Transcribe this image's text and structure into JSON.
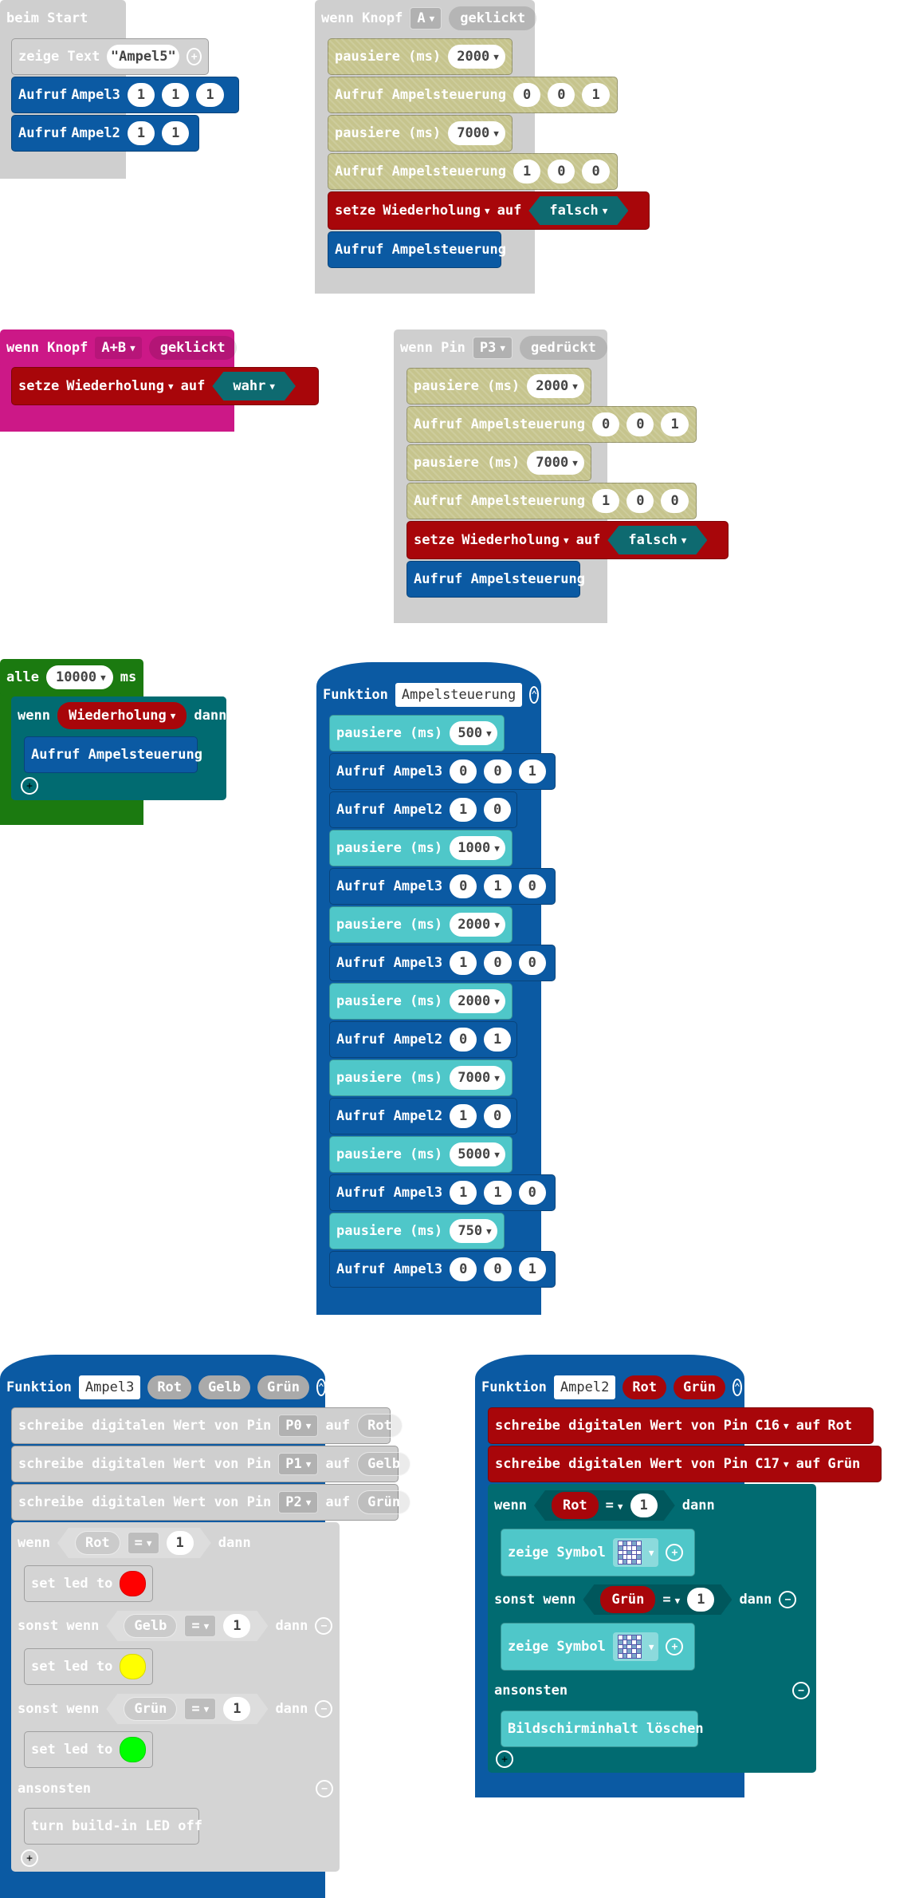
{
  "start": {
    "hat": "beim Start",
    "show_text": "zeige Text",
    "text_value": "\"Ampel5\"",
    "call": "Aufruf",
    "ampel3": "Ampel3",
    "ampel3_args": [
      "1",
      "1",
      "1"
    ],
    "ampel2": "Ampel2",
    "ampel2_args": [
      "1",
      "1"
    ]
  },
  "button_a": {
    "when": "wenn Knopf",
    "button": "A",
    "event": "geklickt",
    "steps": [
      {
        "label": "pausiere (ms)",
        "value": "2000"
      },
      {
        "label": "Aufruf Ampelsteuerung",
        "args": [
          "0",
          "0",
          "1"
        ]
      },
      {
        "label": "pausiere (ms)",
        "value": "7000"
      },
      {
        "label": "Aufruf Ampelsteuerung",
        "args": [
          "1",
          "0",
          "0"
        ]
      }
    ],
    "set": "setze",
    "var": "Wiederholung",
    "to": "auf",
    "value": "falsch",
    "call": "Aufruf Ampelsteuerung"
  },
  "button_ab": {
    "when": "wenn Knopf",
    "button": "A+B",
    "event": "geklickt",
    "set": "setze",
    "var": "Wiederholung",
    "to": "auf",
    "value": "wahr"
  },
  "pin_p3": {
    "when": "wenn Pin",
    "pin": "P3",
    "event": "gedrückt",
    "steps": [
      {
        "label": "pausiere (ms)",
        "value": "2000"
      },
      {
        "label": "Aufruf Ampelsteuerung",
        "args": [
          "0",
          "0",
          "1"
        ]
      },
      {
        "label": "pausiere (ms)",
        "value": "7000"
      },
      {
        "label": "Aufruf Ampelsteuerung",
        "args": [
          "1",
          "0",
          "0"
        ]
      }
    ],
    "set": "setze",
    "var": "Wiederholung",
    "to": "auf",
    "value": "falsch",
    "call": "Aufruf Ampelsteuerung"
  },
  "every": {
    "every": "alle",
    "interval": "10000",
    "unit": "ms",
    "if": "wenn",
    "var": "Wiederholung",
    "then": "dann",
    "call": "Aufruf Ampelsteuerung"
  },
  "func_ampelsteuerung": {
    "keyword": "Funktion",
    "name": "Ampelsteuerung",
    "steps": [
      {
        "type": "pause",
        "label": "pausiere (ms)",
        "value": "500"
      },
      {
        "type": "call",
        "label": "Aufruf Ampel3",
        "args": [
          "0",
          "0",
          "1"
        ]
      },
      {
        "type": "call",
        "label": "Aufruf Ampel2",
        "args": [
          "1",
          "0"
        ]
      },
      {
        "type": "pause",
        "label": "pausiere (ms)",
        "value": "1000"
      },
      {
        "type": "call",
        "label": "Aufruf Ampel3",
        "args": [
          "0",
          "1",
          "0"
        ]
      },
      {
        "type": "pause",
        "label": "pausiere (ms)",
        "value": "2000"
      },
      {
        "type": "call",
        "label": "Aufruf Ampel3",
        "args": [
          "1",
          "0",
          "0"
        ]
      },
      {
        "type": "pause",
        "label": "pausiere (ms)",
        "value": "2000"
      },
      {
        "type": "call",
        "label": "Aufruf Ampel2",
        "args": [
          "0",
          "1"
        ]
      },
      {
        "type": "pause",
        "label": "pausiere (ms)",
        "value": "7000"
      },
      {
        "type": "call",
        "label": "Aufruf Ampel2",
        "args": [
          "1",
          "0"
        ]
      },
      {
        "type": "pause",
        "label": "pausiere (ms)",
        "value": "5000"
      },
      {
        "type": "call",
        "label": "Aufruf Ampel3",
        "args": [
          "1",
          "1",
          "0"
        ]
      },
      {
        "type": "pause",
        "label": "pausiere (ms)",
        "value": "750"
      },
      {
        "type": "call",
        "label": "Aufruf Ampel3",
        "args": [
          "0",
          "0",
          "1"
        ]
      }
    ]
  },
  "func_ampel3": {
    "keyword": "Funktion",
    "name": "Ampel3",
    "params": [
      "Rot",
      "Gelb",
      "Grün"
    ],
    "writes": [
      {
        "label": "schreibe digitalen Wert von Pin",
        "pin": "P0",
        "to": "auf",
        "param": "Rot"
      },
      {
        "label": "schreibe digitalen Wert von Pin",
        "pin": "P1",
        "to": "auf",
        "param": "Gelb"
      },
      {
        "label": "schreibe digitalen Wert von Pin",
        "pin": "P2",
        "to": "auf",
        "param": "Grün"
      }
    ],
    "if": "wenn",
    "elseif": "sonst wenn",
    "else": "ansonsten",
    "then": "dann",
    "eq": "=",
    "one": "1",
    "set_led": "set led to",
    "off": "turn build-in LED off",
    "colors": {
      "red": "#ff0000",
      "yellow": "#ffff00",
      "green": "#00ff00"
    }
  },
  "func_ampel2": {
    "keyword": "Funktion",
    "name": "Ampel2",
    "params": [
      "Rot",
      "Grün"
    ],
    "writes": [
      {
        "label": "schreibe digitalen Wert von Pin",
        "pin": "C16",
        "to": "auf",
        "param": "Rot"
      },
      {
        "label": "schreibe digitalen Wert von Pin",
        "pin": "C17",
        "to": "auf",
        "param": "Grün"
      }
    ],
    "if": "wenn",
    "elseif": "sonst wenn",
    "else": "ansonsten",
    "then": "dann",
    "eq": "=",
    "one": "1",
    "show_symbol": "zeige Symbol",
    "clear": "Bildschirminhalt löschen"
  },
  "colors": {
    "gray": "#cfcfcf",
    "blue": "#0b5aa3",
    "red": "#a8060a",
    "magenta": "#cc1887",
    "green": "#1b7a10",
    "teal": "#016b71",
    "cyan": "#4fc7c9",
    "olive": "#c6c48d"
  }
}
